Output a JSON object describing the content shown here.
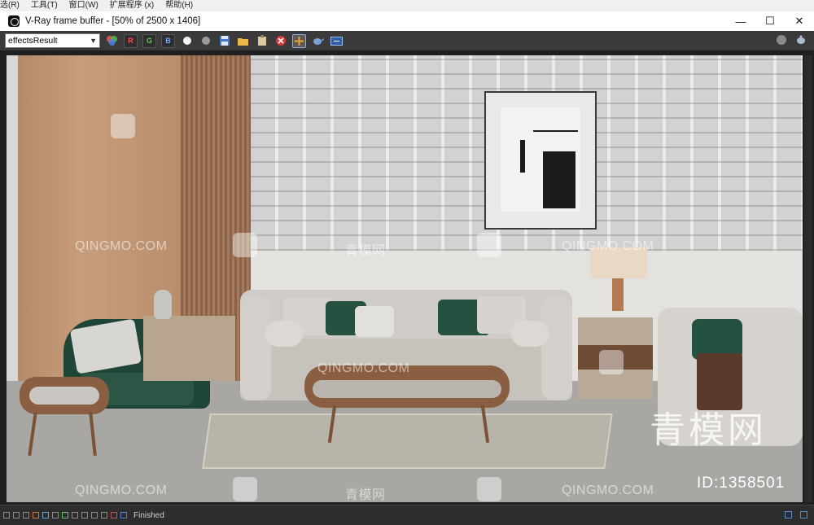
{
  "host_menu": [
    "选(R)",
    "工具(T)",
    "窗口(W)",
    "扩展程序 (x)",
    "帮助(H)"
  ],
  "window": {
    "title": "V-Ray frame buffer - [50% of 2500 x 1406]",
    "minimize": "—",
    "maximize": "☐",
    "close": "✕"
  },
  "toolbar": {
    "channel_value": "effectsResult",
    "r_label": "R",
    "g_label": "G",
    "b_label": "B"
  },
  "render": {
    "watermarks": [
      "QINGMO.COM",
      "QINGMO.COM",
      "QINGMO.COM",
      "QINGMO.COM",
      "QINGMO.COM",
      "青模网",
      "青模网"
    ],
    "brand_cn": "青模网",
    "brand_id": "ID:1358501"
  },
  "statusbar": {
    "status": "Finished"
  },
  "colors": {
    "toolbar_bg": "#3a3a3a",
    "status_bg": "#2d2d2d",
    "sofa_green_pillow": "#245140",
    "wood": "#c79d7c"
  }
}
